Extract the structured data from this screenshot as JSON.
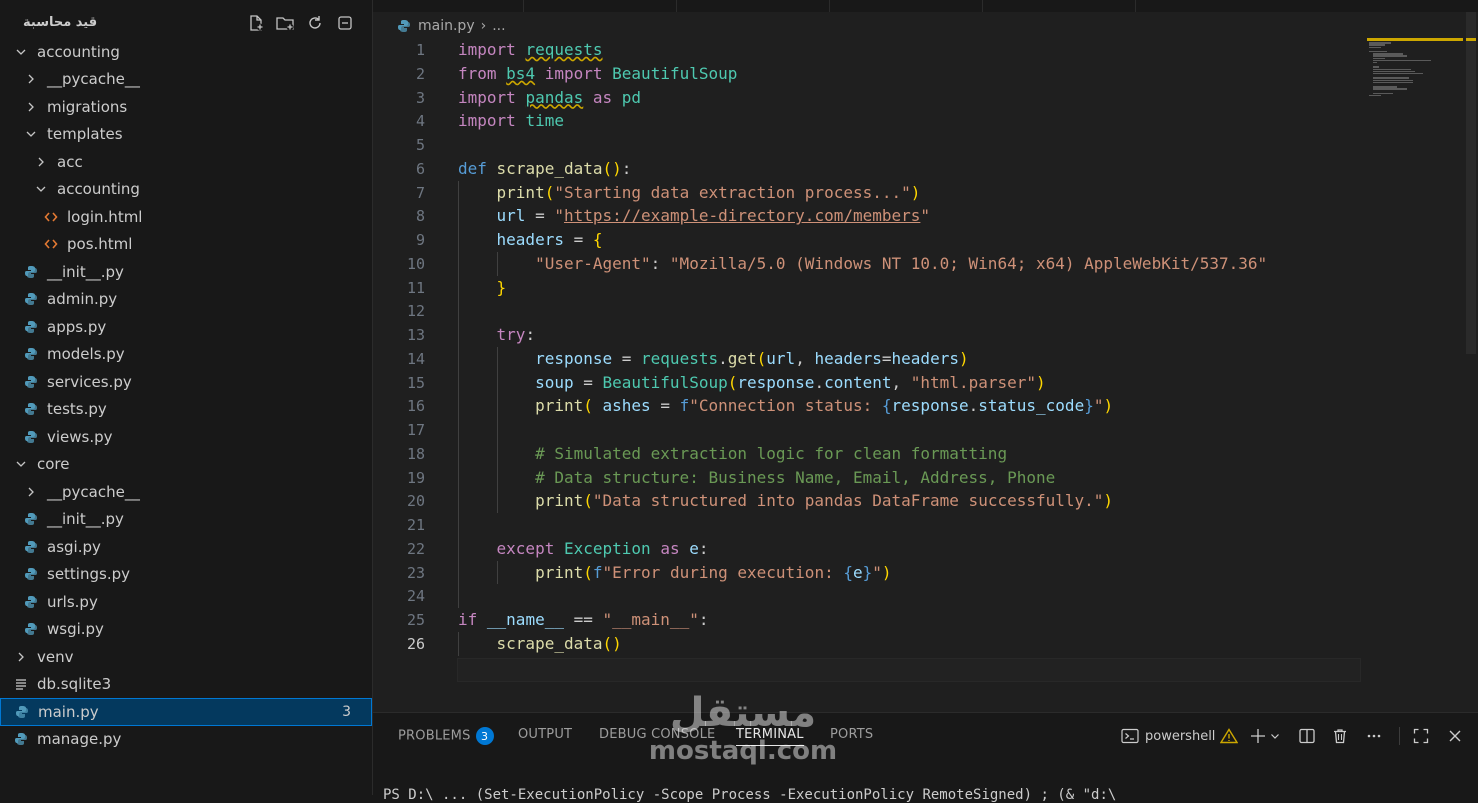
{
  "sidebar": {
    "title": "قيد محاسبة",
    "actions": [
      "new-file-icon",
      "new-folder-icon",
      "refresh-icon",
      "collapse-all-icon"
    ],
    "tree": [
      {
        "label": "accounting",
        "type": "folder-open",
        "indent": 0
      },
      {
        "label": "__pycache__",
        "type": "folder",
        "indent": 1
      },
      {
        "label": "migrations",
        "type": "folder",
        "indent": 1
      },
      {
        "label": "templates",
        "type": "folder-open",
        "indent": 1
      },
      {
        "label": "acc",
        "type": "folder",
        "indent": 2
      },
      {
        "label": "accounting",
        "type": "folder-open",
        "indent": 2
      },
      {
        "label": "login.html",
        "type": "html",
        "indent": 3
      },
      {
        "label": "pos.html",
        "type": "html",
        "indent": 3
      },
      {
        "label": "__init__.py",
        "type": "py",
        "indent": 1
      },
      {
        "label": "admin.py",
        "type": "py",
        "indent": 1
      },
      {
        "label": "apps.py",
        "type": "py",
        "indent": 1
      },
      {
        "label": "models.py",
        "type": "py",
        "indent": 1
      },
      {
        "label": "services.py",
        "type": "py",
        "indent": 1
      },
      {
        "label": "tests.py",
        "type": "py",
        "indent": 1
      },
      {
        "label": "views.py",
        "type": "py",
        "indent": 1
      },
      {
        "label": "core",
        "type": "folder-open",
        "indent": 0
      },
      {
        "label": "__pycache__",
        "type": "folder",
        "indent": 1
      },
      {
        "label": "__init__.py",
        "type": "py",
        "indent": 1
      },
      {
        "label": "asgi.py",
        "type": "py",
        "indent": 1
      },
      {
        "label": "settings.py",
        "type": "py",
        "indent": 1
      },
      {
        "label": "urls.py",
        "type": "py",
        "indent": 1
      },
      {
        "label": "wsgi.py",
        "type": "py",
        "indent": 1
      },
      {
        "label": "venv",
        "type": "folder",
        "indent": 0
      },
      {
        "label": "db.sqlite3",
        "type": "db",
        "indent": 0
      },
      {
        "label": "main.py",
        "type": "py",
        "indent": 0,
        "selected": true,
        "badge": "3"
      },
      {
        "label": "manage.py",
        "type": "py",
        "indent": 0
      }
    ]
  },
  "editor": {
    "breadcrumb": {
      "file": "main.py",
      "sep": "›",
      "more": "..."
    },
    "active_line": "26",
    "lines": [
      {
        "n": "1",
        "code": "<span class='k'>import</span> <span class='n sq'>requests</span>"
      },
      {
        "n": "2",
        "code": "<span class='k'>from</span> <span class='n sq'>bs4</span> <span class='k'>import</span> <span class='n'>BeautifulSoup</span>"
      },
      {
        "n": "3",
        "code": "<span class='k'>import</span> <span class='n sq'>pandas</span> <span class='k'>as</span> <span class='n'>pd</span>"
      },
      {
        "n": "4",
        "code": "<span class='k'>import</span> <span class='n'>time</span>"
      },
      {
        "n": "5",
        "code": ""
      },
      {
        "n": "6",
        "code": "<span class='kd'>def</span> <span class='f'>scrape_data</span><span class='b'>()</span>:"
      },
      {
        "n": "7",
        "code": "    <span class='f'>print</span><span class='b'>(</span><span class='s'>\"Starting data extraction process...\"</span><span class='b'>)</span>"
      },
      {
        "n": "8",
        "code": "    <span class='v'>url</span> = <span class='s'>\"<span class='ul'>https://example-directory.com/members</span>\"</span>"
      },
      {
        "n": "9",
        "code": "    <span class='v'>headers</span> = <span class='b'>{</span>"
      },
      {
        "n": "10",
        "code": "        <span class='s'>\"User-Agent\"</span>: <span class='s'>\"Mozilla/5.0 (Windows NT 10.0; Win64; x64) AppleWebKit/537.36\"</span>"
      },
      {
        "n": "11",
        "code": "    <span class='b'>}</span>"
      },
      {
        "n": "12",
        "code": ""
      },
      {
        "n": "13",
        "code": "    <span class='k'>try</span>:"
      },
      {
        "n": "14",
        "code": "        <span class='v'>response</span> = <span class='n'>requests</span>.<span class='f'>get</span><span class='b'>(</span><span class='v'>url</span>, <span class='v'>headers</span>=<span class='v'>headers</span><span class='b'>)</span>"
      },
      {
        "n": "15",
        "code": "        <span class='v'>soup</span> = <span class='n'>BeautifulSoup</span><span class='b'>(</span><span class='v'>response</span>.<span class='v'>content</span>, <span class='s'>\"html.parser\"</span><span class='b'>)</span>"
      },
      {
        "n": "16",
        "code": "        <span class='f'>print</span><span class='b'>(</span> <span class='v'>ashes</span> = <span class='kd'>f</span><span class='s'>\"Connection status: </span><span class='kd'>{</span><span class='v'>response</span>.<span class='v'>status_code</span><span class='kd'>}</span><span class='s'>\"</span><span class='b'>)</span>"
      },
      {
        "n": "17",
        "code": ""
      },
      {
        "n": "18",
        "code": "        <span class='c'># Simulated extraction logic for clean formatting</span>"
      },
      {
        "n": "19",
        "code": "        <span class='c'># Data structure: Business Name, Email, Address, Phone</span>"
      },
      {
        "n": "20",
        "code": "        <span class='f'>print</span><span class='b'>(</span><span class='s'>\"Data structured into pandas DataFrame successfully.\"</span><span class='b'>)</span>"
      },
      {
        "n": "21",
        "code": ""
      },
      {
        "n": "22",
        "code": "    <span class='k'>except</span> <span class='n'>Exception</span> <span class='k'>as</span> <span class='v'>e</span>:"
      },
      {
        "n": "23",
        "code": "        <span class='f'>print</span><span class='b'>(</span><span class='kd'>f</span><span class='s'>\"Error during execution: </span><span class='kd'>{</span><span class='v'>e</span><span class='kd'>}</span><span class='s'>\"</span><span class='b'>)</span>"
      },
      {
        "n": "24",
        "code": ""
      },
      {
        "n": "25",
        "code": "<span class='k'>if</span> <span class='v'>__name__</span> == <span class='s'>\"__main__\"</span>:"
      },
      {
        "n": "26",
        "code": "    <span class='f'>scrape_data</span><span class='b'>()</span>"
      }
    ]
  },
  "panel": {
    "tabs": [
      {
        "label": "PROBLEMS",
        "badge": "3"
      },
      {
        "label": "OUTPUT"
      },
      {
        "label": "DEBUG CONSOLE"
      },
      {
        "label": "TERMINAL",
        "active": true
      },
      {
        "label": "PORTS"
      }
    ],
    "terminal_name": "powershell",
    "terminal_line": "PS D:\\ ... (Set-ExecutionPolicy -Scope Process -ExecutionPolicy RemoteSigned) ; (& \"d:\\"
  },
  "watermark": {
    "arabic": "مستقل",
    "latin": "mostaql.com"
  },
  "colors": {
    "accent": "#0078d4",
    "warning": "#cca700",
    "python_icon": "#519aba",
    "html_icon": "#e37933"
  }
}
